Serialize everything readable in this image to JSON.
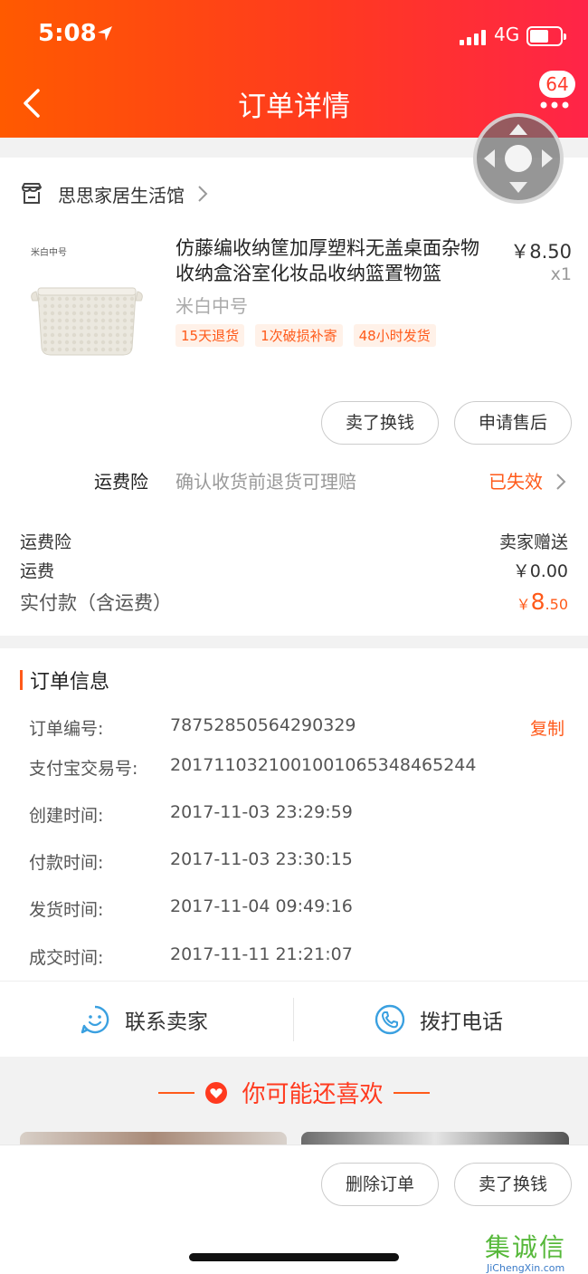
{
  "status_bar": {
    "time": "5:08",
    "network": "4G"
  },
  "header": {
    "title": "订单详情",
    "message_count": "64"
  },
  "shop": {
    "name": "思思家居生活馆"
  },
  "product": {
    "image_tag": "米白中号",
    "title": "仿藤编收纳筐加厚塑料无盖桌面杂物收纳盒浴室化妆品收纳篮置物篮",
    "price": "￥8.50",
    "quantity": "x1",
    "sku": "米白中号",
    "tags": [
      "15天退货",
      "1次破损补寄",
      "48小时发货"
    ]
  },
  "item_actions": {
    "sell": "卖了换钱",
    "after_sale": "申请售后"
  },
  "shipping_insurance": {
    "label": "运费险",
    "desc": "确认收货前退货可理赔",
    "status": "已失效"
  },
  "fees": {
    "insurance_label": "运费险",
    "insurance_value": "卖家赠送",
    "shipping_label": "运费",
    "shipping_value": "￥0.00",
    "paid_label": "实付款（含运费）",
    "paid_currency": "￥",
    "paid_int": "8",
    "paid_dec": ".50"
  },
  "order_info": {
    "title": "订单信息",
    "copy": "复制",
    "rows": [
      {
        "label": "订单编号:",
        "value": "78752850564290329"
      },
      {
        "label": "支付宝交易号:",
        "value": "2017110321001001065348465244"
      },
      {
        "label": "创建时间:",
        "value": "2017-11-03 23:29:59"
      },
      {
        "label": "付款时间:",
        "value": "2017-11-03 23:30:15"
      },
      {
        "label": "发货时间:",
        "value": "2017-11-04 09:49:16"
      },
      {
        "label": "成交时间:",
        "value": "2017-11-11 21:21:07"
      }
    ]
  },
  "contact": {
    "seller": "联系卖家",
    "phone": "拨打电话"
  },
  "recommend": {
    "title": "你可能还喜欢"
  },
  "bottom_actions": {
    "delete": "删除订单",
    "sell": "卖了换钱"
  },
  "watermark": {
    "cn": "集诚信",
    "en": "JiChengXin.com"
  },
  "colors": {
    "accent": "#ff5a1a",
    "header_start": "#ff5a00",
    "header_end": "#ff2448",
    "contact_icon": "#3aa0e0"
  }
}
